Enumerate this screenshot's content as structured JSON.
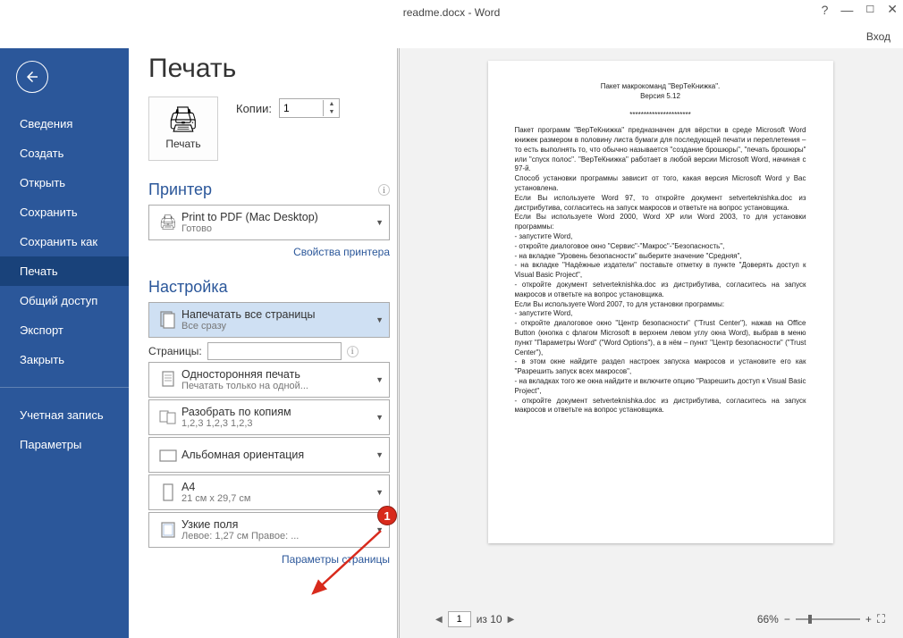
{
  "window": {
    "title": "readme.docx - Word",
    "help": "?",
    "signin": "Вход"
  },
  "nav": {
    "items": [
      "Сведения",
      "Создать",
      "Открыть",
      "Сохранить",
      "Сохранить как",
      "Печать",
      "Общий доступ",
      "Экспорт",
      "Закрыть"
    ],
    "active_index": 5,
    "footer": [
      "Учетная запись",
      "Параметры"
    ]
  },
  "print": {
    "title": "Печать",
    "button": "Печать",
    "copies_label": "Копии:",
    "copies_value": "1",
    "printer_h": "Принтер",
    "printer_name": "Print to PDF (Mac Desktop)",
    "printer_status": "Готово",
    "printer_props": "Свойства принтера",
    "settings_h": "Настройка",
    "pages_label": "Страницы:",
    "pages_value": "",
    "options": [
      {
        "icon": "pages-all",
        "title": "Напечатать все страницы",
        "sub": "Все сразу",
        "selected": true
      },
      {
        "icon": "one-side",
        "title": "Односторонняя печать",
        "sub": "Печатать только на одной..."
      },
      {
        "icon": "collate",
        "title": "Разобрать по копиям",
        "sub": "1,2,3   1,2,3   1,2,3"
      },
      {
        "icon": "landscape",
        "title": "Альбомная ориентация",
        "sub": ""
      },
      {
        "icon": "a4",
        "title": "A4",
        "sub": "21 см x 29,7 см"
      },
      {
        "icon": "margins",
        "title": "Узкие поля",
        "sub": "Левое:  1,27 см   Правое:  ..."
      }
    ],
    "page_setup": "Параметры страницы"
  },
  "preview": {
    "page_lines_center": [
      "Пакет макрокоманд \"ВерТеКнижка\".",
      "Версия 5.12",
      "",
      "**********************"
    ],
    "page_lines": [
      "    Пакет программ \"ВерТеКнижка\" предназначен для вёрстки в среде Microsoft Word книжек размером в половину листа бумаги для последующей печати и переплетения – то есть выполнять то, что обычно называется \"создание брошюры\", \"печать брошюры\" или \"спуск полос\". \"ВерТеКнижка\" работает в любой версии Microsoft Word, начиная с 97-й.",
      "    Способ установки программы зависит от того, какая версия Microsoft Word у Вас установлена.",
      "    Если Вы используете Word 97, то откройте документ setverteknishka.doc из дистрибутива, согласитесь на запуск макросов и ответьте на вопрос установщика.",
      "    Если Вы используете Word 2000, Word XP или Word 2003, то для установки программы:",
      "- запустите Word,",
      "- откройте диалоговое окно \"Сервис\"-\"Макрос\"-\"Безопасность\",",
      "- на вкладке \"Уровень безопасности\" выберите значение \"Средняя\",",
      "- на вкладке \"Надёжные издатели\" поставьте отметку в пункте \"Доверять доступ к Visual Basic Project\",",
      "- откройте документ setverteknishka.doc из дистрибутива, согласитесь на запуск макросов и ответьте на вопрос установщика.",
      "    Если Вы используете Word 2007, то для установки программы:",
      "- запустите Word,",
      "- откройте диалоговое окно \"Центр безопасности\" (\"Trust Center\"), нажав на Office Button (кнопка с флагом Microsoft в верхнем левом углу окна Word), выбрав в меню пункт \"Параметры Word\" (\"Word Options\"), а в нём – пункт \"Центр безопасности\" (\"Trust Center\"),",
      "- в этом окне найдите раздел настроек запуска макросов и установите его как \"Разрешить запуск всех макросов\",",
      "- на вкладках того же окна найдите и включите опцию \"Разрешить доступ к Visual Basic Project\",",
      "- откройте документ setverteknishka.doc из дистрибутива, согласитесь на запуск макросов и ответьте на вопрос установщика."
    ],
    "page_num": "1",
    "page_total": "из 10",
    "zoom_pct": "66%"
  },
  "callout": {
    "num": "1"
  }
}
